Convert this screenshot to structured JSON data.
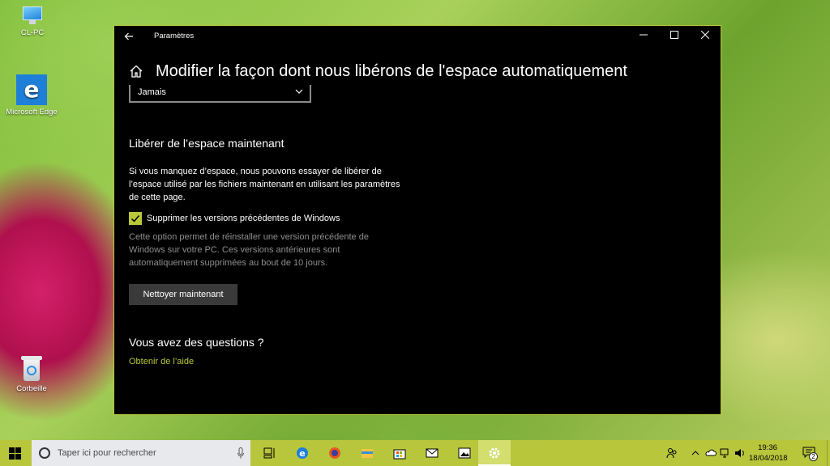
{
  "desktop": {
    "icons": [
      {
        "label": "CL-PC",
        "icon": "computer-icon"
      },
      {
        "label": "Microsoft Edge",
        "icon": "edge-icon"
      },
      {
        "label": "Corbeille",
        "icon": "recycle-bin-icon"
      }
    ]
  },
  "window": {
    "title": "Paramètres",
    "back_icon": "back-arrow-icon",
    "controls": {
      "minimize": "minimize-icon",
      "maximize": "maximize-icon",
      "close": "close-icon"
    }
  },
  "page": {
    "title": "Modifier la façon dont nous libérons de l'espace automatiquement",
    "dropdown_value": "Jamais",
    "section_title": "Libérer de l’espace maintenant",
    "description": "Si vous manquez d’espace, nous pouvons essayer de libérer de l’espace utilisé par les fichiers maintenant en utilisant les paramètres de cette page.",
    "checkbox_label": "Supprimer les versions précédentes de Windows",
    "checkbox_checked": true,
    "hint": "Cette option permet de réinstaller une version précédente de Windows sur votre PC. Ces versions antérieures sont automatiquement supprimées au bout de 10 jours.",
    "clean_button": "Nettoyer maintenant",
    "questions_title": "Vous avez des questions ?",
    "help_link": "Obtenir de l’aide"
  },
  "taskbar": {
    "search_placeholder": "Taper ici pour rechercher",
    "time": "19:36",
    "date": "18/04/2018",
    "notification_count": "2",
    "accent_color": "#b8c63c",
    "apps": [
      "task-view-icon",
      "edge-icon",
      "firefox-icon",
      "file-explorer-icon",
      "store-icon",
      "mail-icon",
      "photos-icon",
      "settings-icon"
    ]
  }
}
